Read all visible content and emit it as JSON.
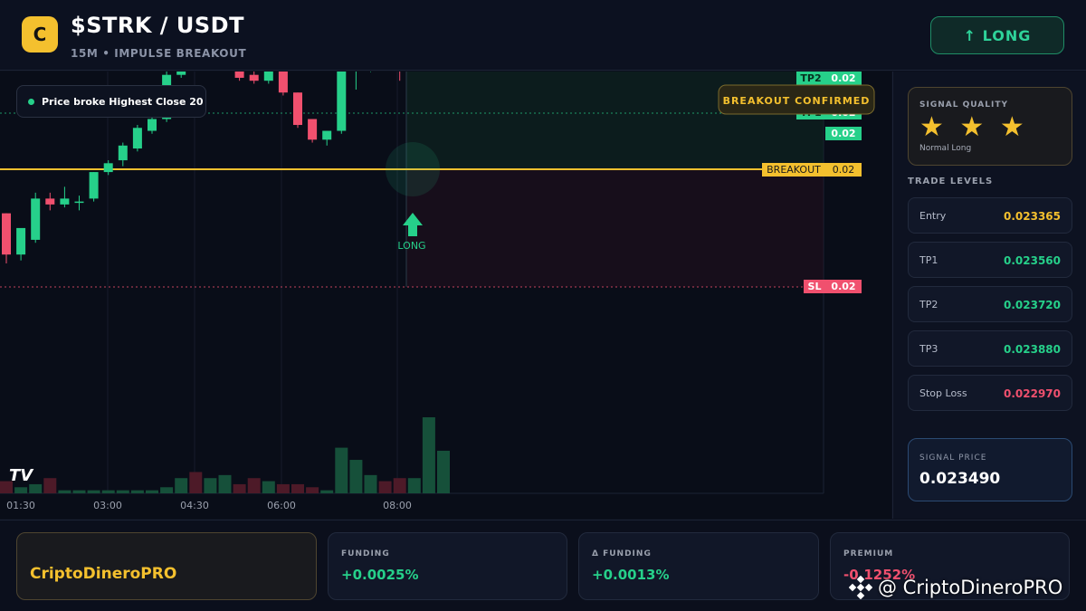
{
  "header": {
    "logo_letter": "C",
    "pair": "$STRK / USDT",
    "subtitle": "15M • IMPULSE BREAKOUT",
    "long_button": "↑ LONG"
  },
  "chart": {
    "note": "Price broke Highest Close 20",
    "breakout_confirmed": "BREAKOUT CONFIRMED",
    "long_marker": "LONG",
    "tv_logo": "TV",
    "price_tags": {
      "tp2_label": "TP2",
      "tp2_value": "0.02",
      "tp1_label": "TP1",
      "tp1_value": "0.02",
      "current_value": "0.02",
      "breakout_label": "BREAKOUT",
      "breakout_value": "0.02",
      "sl_label": "SL",
      "sl_value": "0.02"
    },
    "time_ticks": [
      "01:30",
      "03:00",
      "04:30",
      "06:00",
      "08:00"
    ]
  },
  "chart_data": {
    "type": "candlestick",
    "candles": [
      {
        "o": 0.02322,
        "h": 0.02322,
        "c": 0.02308,
        "l": 0.02305,
        "dir": "down"
      },
      {
        "o": 0.02308,
        "h": 0.02312,
        "c": 0.02317,
        "l": 0.02306,
        "dir": "up"
      },
      {
        "o": 0.02313,
        "h": 0.02329,
        "c": 0.02327,
        "l": 0.02312,
        "dir": "up"
      },
      {
        "o": 0.02327,
        "h": 0.02329,
        "c": 0.02325,
        "l": 0.02323,
        "dir": "down"
      },
      {
        "o": 0.02325,
        "h": 0.02331,
        "c": 0.02327,
        "l": 0.02324,
        "dir": "up"
      },
      {
        "o": 0.02326,
        "h": 0.02328,
        "c": 0.02326,
        "l": 0.02323,
        "dir": "up"
      },
      {
        "o": 0.02327,
        "h": 0.02336,
        "c": 0.02336,
        "l": 0.02326,
        "dir": "up"
      },
      {
        "o": 0.02336,
        "h": 0.0234,
        "c": 0.02339,
        "l": 0.02335,
        "dir": "up"
      },
      {
        "o": 0.0234,
        "h": 0.02346,
        "c": 0.02345,
        "l": 0.02338,
        "dir": "up"
      },
      {
        "o": 0.02344,
        "h": 0.02352,
        "c": 0.02351,
        "l": 0.02343,
        "dir": "up"
      },
      {
        "o": 0.0235,
        "h": 0.02356,
        "c": 0.02354,
        "l": 0.02349,
        "dir": "up"
      },
      {
        "o": 0.02354,
        "h": 0.02371,
        "c": 0.02369,
        "l": 0.02353,
        "dir": "up"
      },
      {
        "o": 0.02369,
        "h": 0.02383,
        "c": 0.02381,
        "l": 0.02368,
        "dir": "up"
      },
      {
        "o": 0.02381,
        "h": 0.02381,
        "c": 0.02374,
        "l": 0.02373,
        "dir": "down"
      },
      {
        "o": 0.02375,
        "h": 0.02385,
        "c": 0.02377,
        "l": 0.02373,
        "dir": "up"
      },
      {
        "o": 0.02377,
        "h": 0.02381,
        "c": 0.02377,
        "l": 0.02376,
        "dir": "up"
      },
      {
        "o": 0.02377,
        "h": 0.02377,
        "c": 0.02368,
        "l": 0.02367,
        "dir": "down"
      },
      {
        "o": 0.02369,
        "h": 0.02372,
        "c": 0.02367,
        "l": 0.02366,
        "dir": "down"
      },
      {
        "o": 0.02367,
        "h": 0.02372,
        "c": 0.02371,
        "l": 0.02366,
        "dir": "up"
      },
      {
        "o": 0.02371,
        "h": 0.02371,
        "c": 0.02363,
        "l": 0.02362,
        "dir": "down"
      },
      {
        "o": 0.02363,
        "h": 0.02363,
        "c": 0.02352,
        "l": 0.02351,
        "dir": "down"
      },
      {
        "o": 0.02354,
        "h": 0.02354,
        "c": 0.02347,
        "l": 0.02346,
        "dir": "down"
      },
      {
        "o": 0.02347,
        "h": 0.0235,
        "c": 0.0235,
        "l": 0.02345,
        "dir": "up"
      },
      {
        "o": 0.0235,
        "h": 0.02373,
        "c": 0.02372,
        "l": 0.02349,
        "dir": "up"
      },
      {
        "o": 0.02372,
        "h": 0.02372,
        "c": 0.02371,
        "l": 0.02364,
        "dir": "up"
      },
      {
        "o": 0.02371,
        "h": 0.02385,
        "c": 0.02383,
        "l": 0.0237,
        "dir": "up"
      },
      {
        "o": 0.02383,
        "h": 0.0239,
        "c": 0.0238,
        "l": 0.02379,
        "dir": "down"
      },
      {
        "o": 0.02379,
        "h": 0.02384,
        "c": 0.02375,
        "l": 0.02367,
        "dir": "down"
      },
      {
        "o": 0.02377,
        "h": 0.02391,
        "c": 0.02387,
        "l": 0.02376,
        "dir": "up"
      },
      {
        "o": 0.02387,
        "h": 0.02442,
        "c": 0.02434,
        "l": 0.02386,
        "dir": "up"
      },
      {
        "o": 0.02434,
        "h": 0.02434,
        "c": 0.02434,
        "l": 0.02434,
        "dir": "up"
      }
    ],
    "volume": [
      4,
      2,
      3,
      5,
      1,
      1,
      1,
      1,
      1,
      1,
      1,
      2,
      5,
      7,
      5,
      6,
      3,
      5,
      4,
      3,
      3,
      2,
      1,
      15,
      11,
      6,
      4,
      5,
      5,
      25,
      14,
      0
    ],
    "breakout_level": 0.02349,
    "entry": 0.023365,
    "tp1": 0.02356,
    "tp2": 0.02372,
    "stop_loss": 0.02297,
    "colors": {
      "up": "#26d08a",
      "down": "#f0506e",
      "breakout": "#f4c02e"
    }
  },
  "sidebar": {
    "signal_quality_label": "SIGNAL QUALITY",
    "stars": "★ ★ ★",
    "quality_text": "Normal Long",
    "trade_levels_title": "TRADE LEVELS",
    "levels": [
      {
        "label": "Entry",
        "value": "0.023365",
        "color": "#f4c02e"
      },
      {
        "label": "TP1",
        "value": "0.023560",
        "color": "#26d08a"
      },
      {
        "label": "TP2",
        "value": "0.023720",
        "color": "#26d08a"
      },
      {
        "label": "TP3",
        "value": "0.023880",
        "color": "#26d08a"
      },
      {
        "label": "Stop Loss",
        "value": "0.022970",
        "color": "#f0506e"
      }
    ],
    "signal_price_label": "SIGNAL PRICE",
    "signal_price": "0.023490"
  },
  "footer": {
    "brand": "CriptoDineroPRO",
    "funding_label": "FUNDING",
    "funding_value": "+0.0025%",
    "delta_funding_label": "Δ FUNDING",
    "delta_funding_value": "+0.0013%",
    "premium_label": "PREMIUM",
    "premium_value": "-0.1252%",
    "watermark": "@ CriptoDineroPRO"
  }
}
